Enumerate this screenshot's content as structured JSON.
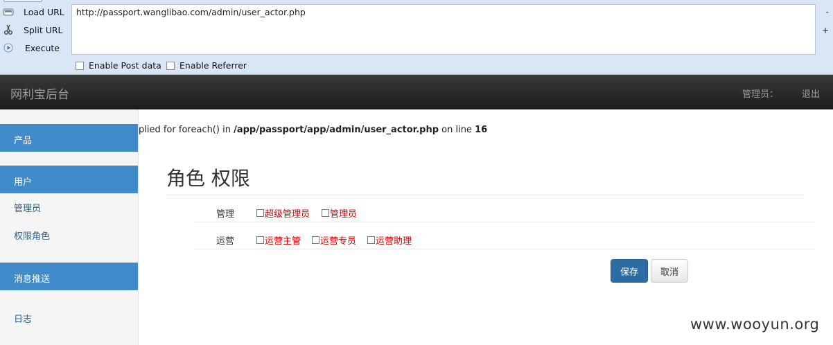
{
  "hackbar": {
    "load_url_label": "Load URL",
    "split_url_label": "Split URL",
    "execute_label": "Execute",
    "url_value": "http://passport.wanglibao.com/admin/user_actor.php",
    "minus_label": "-",
    "plus_label": "+",
    "enable_post_label": "Enable Post data",
    "enable_referrer_label": "Enable Referrer",
    "enable_post_checked": false,
    "enable_referrer_checked": false
  },
  "navbar": {
    "brand": "网利宝后台",
    "user_label": "管理员：",
    "logout": "退出"
  },
  "sidebar": {
    "items": [
      {
        "label": "产品",
        "type": "header"
      },
      {
        "label": "用户",
        "type": "header"
      },
      {
        "label": "管理员",
        "type": "link"
      },
      {
        "label": "权限角色",
        "type": "link"
      },
      {
        "label": "消息推送",
        "type": "header"
      },
      {
        "label": "日志",
        "type": "link"
      }
    ]
  },
  "main": {
    "error": {
      "prefix": "plied for foreach() in ",
      "path": "/app/passport/app/admin/user_actor.php",
      "middle": " on line ",
      "line": "16"
    },
    "title": "角色 权限",
    "groups": [
      {
        "label": "管理",
        "options": [
          "超级管理员",
          "管理员"
        ]
      },
      {
        "label": "运营",
        "options": [
          "运营主管",
          "运营专员",
          "运营助理"
        ]
      }
    ],
    "save_label": "保存",
    "cancel_label": "取消"
  },
  "watermark": "www.wooyun.org",
  "colors": {
    "sidebar_header_bg": "#428bca",
    "navbar_bg": "#222222",
    "primary_button": "#2d6ca2",
    "permission_text": "#e00000",
    "hackbar_bg": "#d9e6f5"
  }
}
